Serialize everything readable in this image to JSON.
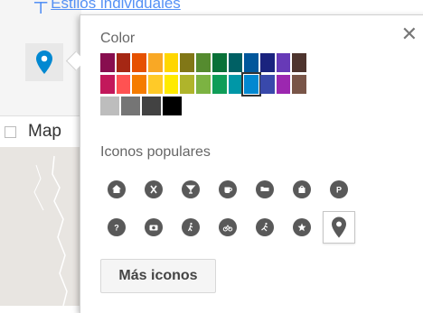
{
  "background": {
    "top_link_text": "Estilos individuales",
    "layer_label": "Map"
  },
  "popup": {
    "color_title": "Color",
    "icons_title": "Iconos populares",
    "more_icons_label": "Más iconos",
    "close_symbol": "✕"
  },
  "colors": {
    "row1": [
      "#880e4f",
      "#a52714",
      "#e65100",
      "#f9a825",
      "#ffd600",
      "#817717",
      "#558b2f",
      "#097138",
      "#006064",
      "#01579b",
      "#1a237e",
      "#673ab7",
      "#4e342e"
    ],
    "row2": [
      "#c2185b",
      "#ff5252",
      "#f57c00",
      "#ffca28",
      "#ffea00",
      "#afb42b",
      "#7cb342",
      "#0f9d58",
      "#0097a7",
      "#0288d1",
      "#3949ab",
      "#9c27b0",
      "#795548"
    ],
    "row3": [
      "#bdbdbd",
      "#757575",
      "#424242",
      "#000000"
    ],
    "selected": "#0288d1",
    "pin_accent": "#0288d1"
  },
  "icons": {
    "row1": [
      "home",
      "restaurant",
      "bar",
      "coffee",
      "hotel",
      "shopping",
      "parking"
    ],
    "row2": [
      "help",
      "camera",
      "hiking",
      "cycling",
      "running",
      "star",
      "place"
    ],
    "selected": "place"
  }
}
